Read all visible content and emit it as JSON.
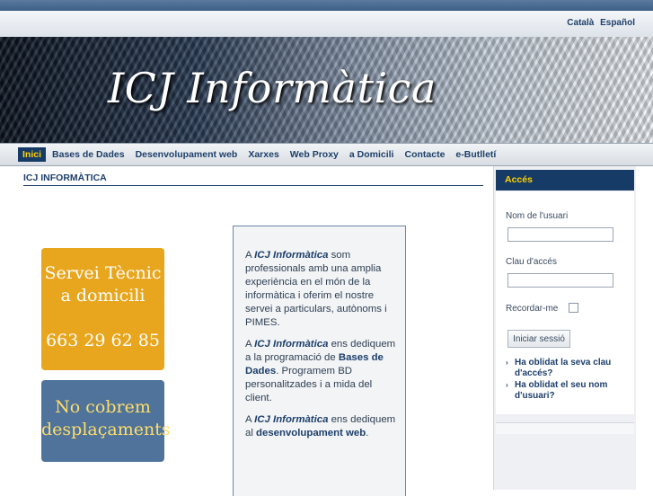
{
  "languages": [
    "Català",
    "Español"
  ],
  "banner": {
    "title": "ICJ Informàtica"
  },
  "nav": [
    {
      "label": "Inici",
      "active": true
    },
    {
      "label": "Bases de Dades"
    },
    {
      "label": "Desenvolupament web"
    },
    {
      "label": "Xarxes"
    },
    {
      "label": "Web Proxy"
    },
    {
      "label": "a Domicili"
    },
    {
      "label": "Contacte"
    },
    {
      "label": "e-Butlletí"
    }
  ],
  "page_title": "ICJ INFORMÀTICA",
  "promo_service": {
    "line1": "Servei Tècnic",
    "line2": "a domicili",
    "phone": "663 29 62 85"
  },
  "promo_travel": {
    "line1": "No cobrem",
    "line2": "desplaçaments"
  },
  "info": {
    "p1_prefix": "A ",
    "p1_brand": "ICJ Informàtica",
    "p1_rest": " som professionals amb una amplia experiència en el món de la informàtica i oferim el nostre servei a particulars, autònoms i PIMES.",
    "p2_prefix": "A ",
    "p2_brand": "ICJ Informàtica",
    "p2_mid": " ens dediquem a la programació de ",
    "p2_hl": "Bases de Dades",
    "p2_rest": ". Programem BD personalitzades i a mida del client.",
    "p3_prefix": "A ",
    "p3_brand": "ICJ Informàtica",
    "p3_mid": " ens dediquem al ",
    "p3_hl": "desenvolupament web",
    "p3_rest": "."
  },
  "login": {
    "title": "Accés",
    "username_label": "Nom de l'usuari",
    "username_value": "",
    "password_label": "Clau d'accés",
    "password_value": "",
    "remember_label": "Recordar-me",
    "remember_checked": false,
    "submit_label": "Iniciar sessió",
    "links": [
      "Ha oblidat la seva clau d'accés?",
      "Ha oblidat el seu nom d'usuari?"
    ]
  },
  "colors": {
    "nav_active_bg": "#163b66",
    "nav_active_text": "#ffd200",
    "promo_service": "#e8a61e",
    "promo_travel": "#4f739a",
    "link": "#1d3f6a"
  }
}
